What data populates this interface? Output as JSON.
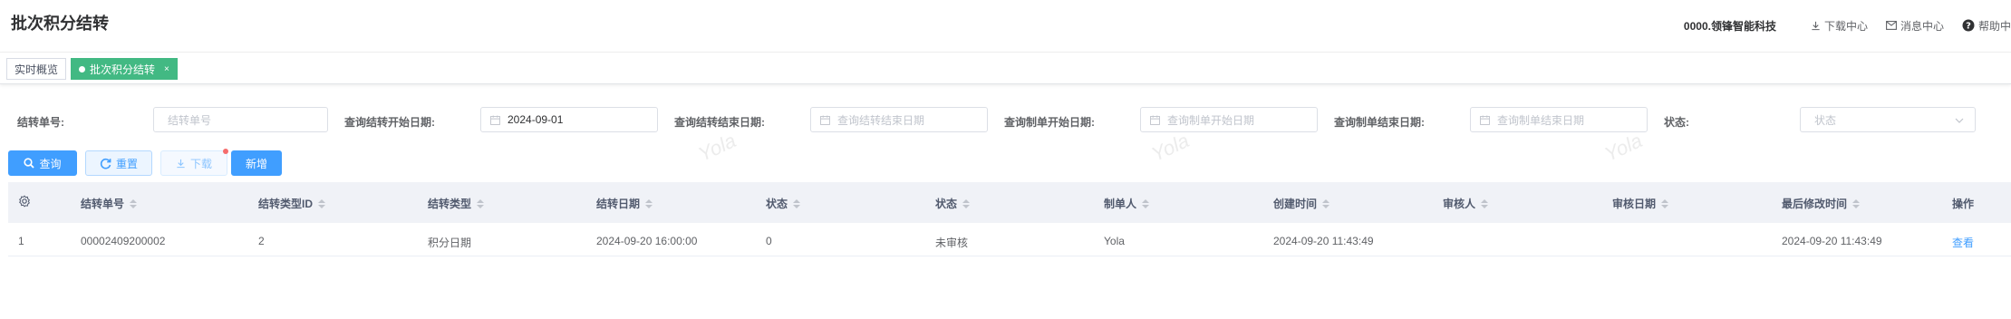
{
  "header": {
    "title": "批次积分结转",
    "org": "0000.领锋智能科技",
    "links": [
      {
        "label": "下载中心",
        "icon": "download-icon"
      },
      {
        "label": "消息中心",
        "icon": "mail-icon"
      },
      {
        "label": "帮助中",
        "icon": "help-icon"
      }
    ]
  },
  "tags": [
    {
      "label": "实时概览",
      "active": false
    },
    {
      "label": "批次积分结转",
      "active": true,
      "close": "×"
    }
  ],
  "watermark": "Yola",
  "filters": {
    "transfer_no": {
      "label": "结转单号:",
      "placeholder": "结转单号"
    },
    "transfer_start": {
      "label": "查询结转开始日期:",
      "value": "2024-09-01"
    },
    "transfer_end": {
      "label": "查询结转结束日期:",
      "placeholder": "查询结转结束日期"
    },
    "create_start": {
      "label": "查询制单开始日期:",
      "placeholder": "查询制单开始日期"
    },
    "create_end": {
      "label": "查询制单结束日期:",
      "placeholder": "查询制单结束日期"
    },
    "status": {
      "label": "状态:",
      "placeholder": "状态"
    }
  },
  "buttons": {
    "query": "查询",
    "reset": "重置",
    "download": "下载",
    "new": "新增"
  },
  "table": {
    "columns": [
      "结转单号",
      "结转类型ID",
      "结转类型",
      "结转日期",
      "状态",
      "状态",
      "制单人",
      "创建时间",
      "审核人",
      "审核日期",
      "最后修改时间",
      "操作"
    ],
    "rows": [
      {
        "index": "1",
        "transfer_no": "00002409200002",
        "type_id": "2",
        "type": "积分日期",
        "date": "2024-09-20 16:00:00",
        "status_code": "0",
        "status": "未审核",
        "creator": "Yola",
        "created_at": "2024-09-20 11:43:49",
        "auditor": "",
        "audit_date": "",
        "modified_at": "2024-09-20 11:43:49",
        "action": "查看"
      }
    ]
  },
  "colors": {
    "primary": "#409eff",
    "tag_active": "#42b983",
    "header_bg": "#f0f2f7"
  }
}
